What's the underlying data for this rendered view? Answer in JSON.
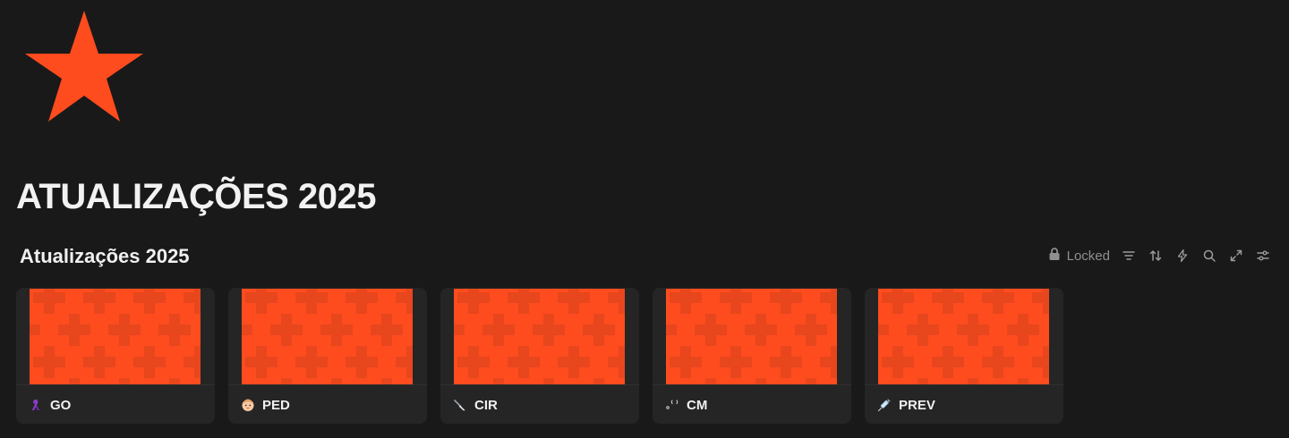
{
  "page": {
    "title": "ATUALIZAÇÕES 2025",
    "icon": "star-icon",
    "accent": "#ff4c1e"
  },
  "database": {
    "title": "Atualizações 2025",
    "toolbar": {
      "locked_label": "Locked",
      "icons": [
        "lock-icon",
        "filter-icon",
        "sort-icon",
        "automation-icon",
        "search-icon",
        "expand-icon",
        "settings-icon"
      ]
    }
  },
  "cards": [
    {
      "name": "GO",
      "icon": "ribbon-icon"
    },
    {
      "name": "PED",
      "icon": "baby-face-icon"
    },
    {
      "name": "CIR",
      "icon": "scalpel-icon"
    },
    {
      "name": "CM",
      "icon": "stethoscope-icon"
    },
    {
      "name": "PREV",
      "icon": "syringe-icon"
    }
  ],
  "cover": {
    "color": "#ff4c1e",
    "pattern_color": "#e8461d"
  }
}
